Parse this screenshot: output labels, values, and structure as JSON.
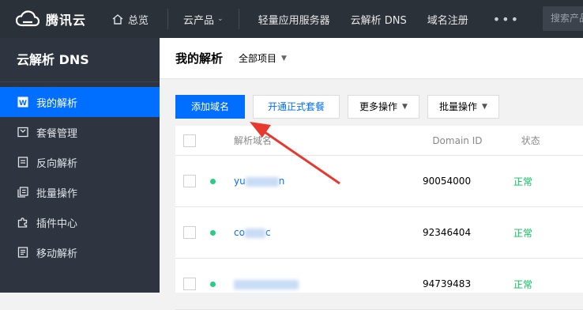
{
  "topbar": {
    "brand": "腾讯云",
    "home": "总览",
    "products": "云产品",
    "links": [
      "轻量应用服务器",
      "云解析 DNS",
      "域名注册"
    ],
    "more": "•••",
    "search_placeholder": "搜索产品"
  },
  "sidebar": {
    "title": "云解析 DNS",
    "items": [
      {
        "label": "我的解析",
        "icon": "my-dns-icon",
        "active": true
      },
      {
        "label": "套餐管理",
        "icon": "package-icon",
        "active": false
      },
      {
        "label": "反向解析",
        "icon": "reverse-dns-icon",
        "active": false
      },
      {
        "label": "批量操作",
        "icon": "batch-icon",
        "active": false
      },
      {
        "label": "插件中心",
        "icon": "plugin-icon",
        "active": false
      },
      {
        "label": "移动解析",
        "icon": "mobile-dns-icon",
        "active": false
      }
    ]
  },
  "main": {
    "title": "我的解析",
    "project": "全部项目",
    "buttons": {
      "add_domain": "添加域名",
      "open_package": "开通正式套餐",
      "more_actions": "更多操作",
      "batch_actions": "批量操作"
    },
    "table": {
      "headers": {
        "domain": "解析域名",
        "domain_id": "Domain ID",
        "status": "状态"
      },
      "rows": [
        {
          "domain_prefix": "yu",
          "domain_suffix": "n",
          "domain_id": "90054000",
          "status": "正常"
        },
        {
          "domain_prefix": "co",
          "domain_suffix": "c",
          "domain_id": "92346404",
          "status": "正常"
        },
        {
          "domain_prefix": "",
          "domain_suffix": "",
          "domain_id": "94739483",
          "status": "正常"
        }
      ]
    }
  },
  "colors": {
    "accent": "#006eff",
    "annotation_arrow": "#e8392f",
    "status_ok": "#0abf5b"
  }
}
